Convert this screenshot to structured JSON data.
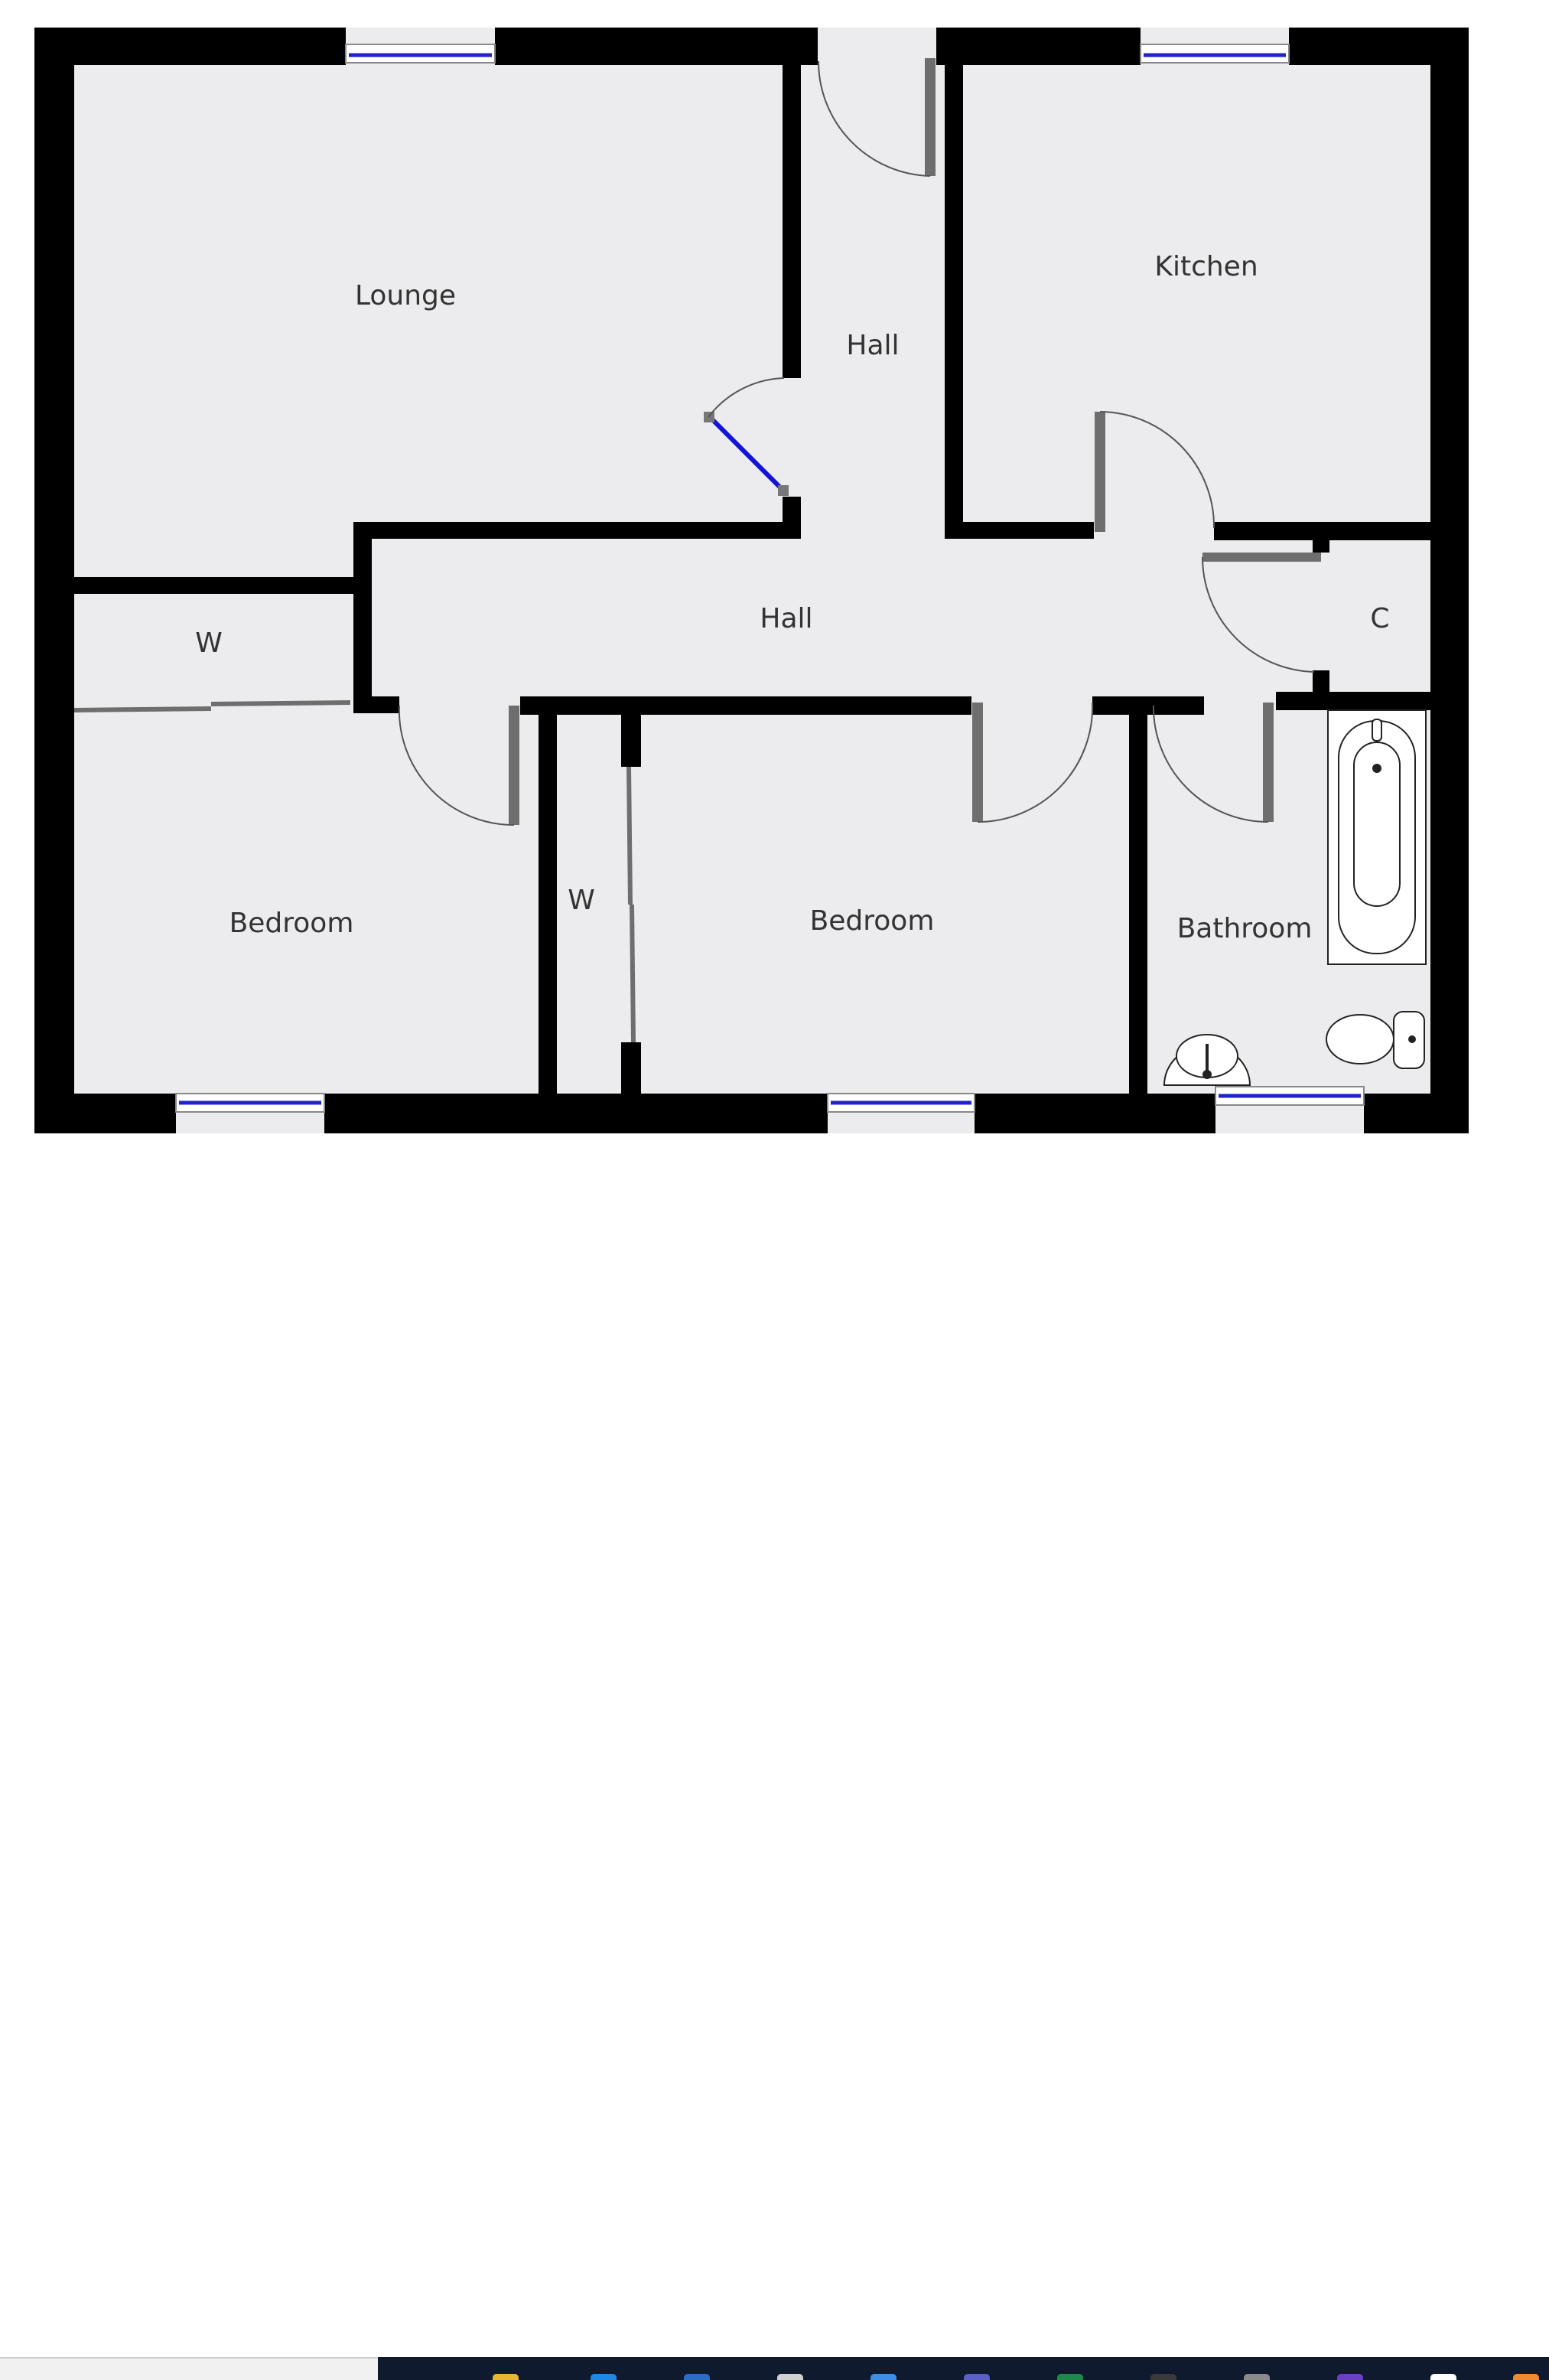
{
  "rooms": {
    "lounge": "Lounge",
    "hall_upper": "Hall",
    "kitchen": "Kitchen",
    "hall_main": "Hall",
    "wardrobe_left": "W",
    "cupboard": "C",
    "bedroom_left": "Bedroom",
    "wardrobe_middle": "W",
    "bedroom_middle": "Bedroom",
    "bathroom": "Bathroom"
  },
  "colors": {
    "floor": "#ececee",
    "wall": "#000000",
    "door_leaf": "#6e6e6e",
    "window_glass": "#2222cc",
    "open_door_highlight": "#1414d8",
    "taskbar": "#0f1a2e"
  },
  "taskbar_icons": [
    {
      "name": "folder-icon",
      "color": "#e8b730"
    },
    {
      "name": "browser-icon",
      "color": "#1e88e5"
    },
    {
      "name": "store-icon",
      "color": "#2b6cc4"
    },
    {
      "name": "settings-icon",
      "color": "#d0d0d0"
    },
    {
      "name": "mail-icon",
      "color": "#3d8ee6"
    },
    {
      "name": "teams-icon",
      "color": "#5b5fc7"
    },
    {
      "name": "excel-icon",
      "color": "#1d8a4a"
    },
    {
      "name": "terminal-icon",
      "color": "#3a3a3a"
    },
    {
      "name": "pen-icon",
      "color": "#8a8a8a"
    },
    {
      "name": "visual-studio-icon",
      "color": "#6c3fc4"
    },
    {
      "name": "document-icon",
      "color": "#ffffff"
    },
    {
      "name": "app-icon",
      "color": "#f28a30"
    }
  ]
}
